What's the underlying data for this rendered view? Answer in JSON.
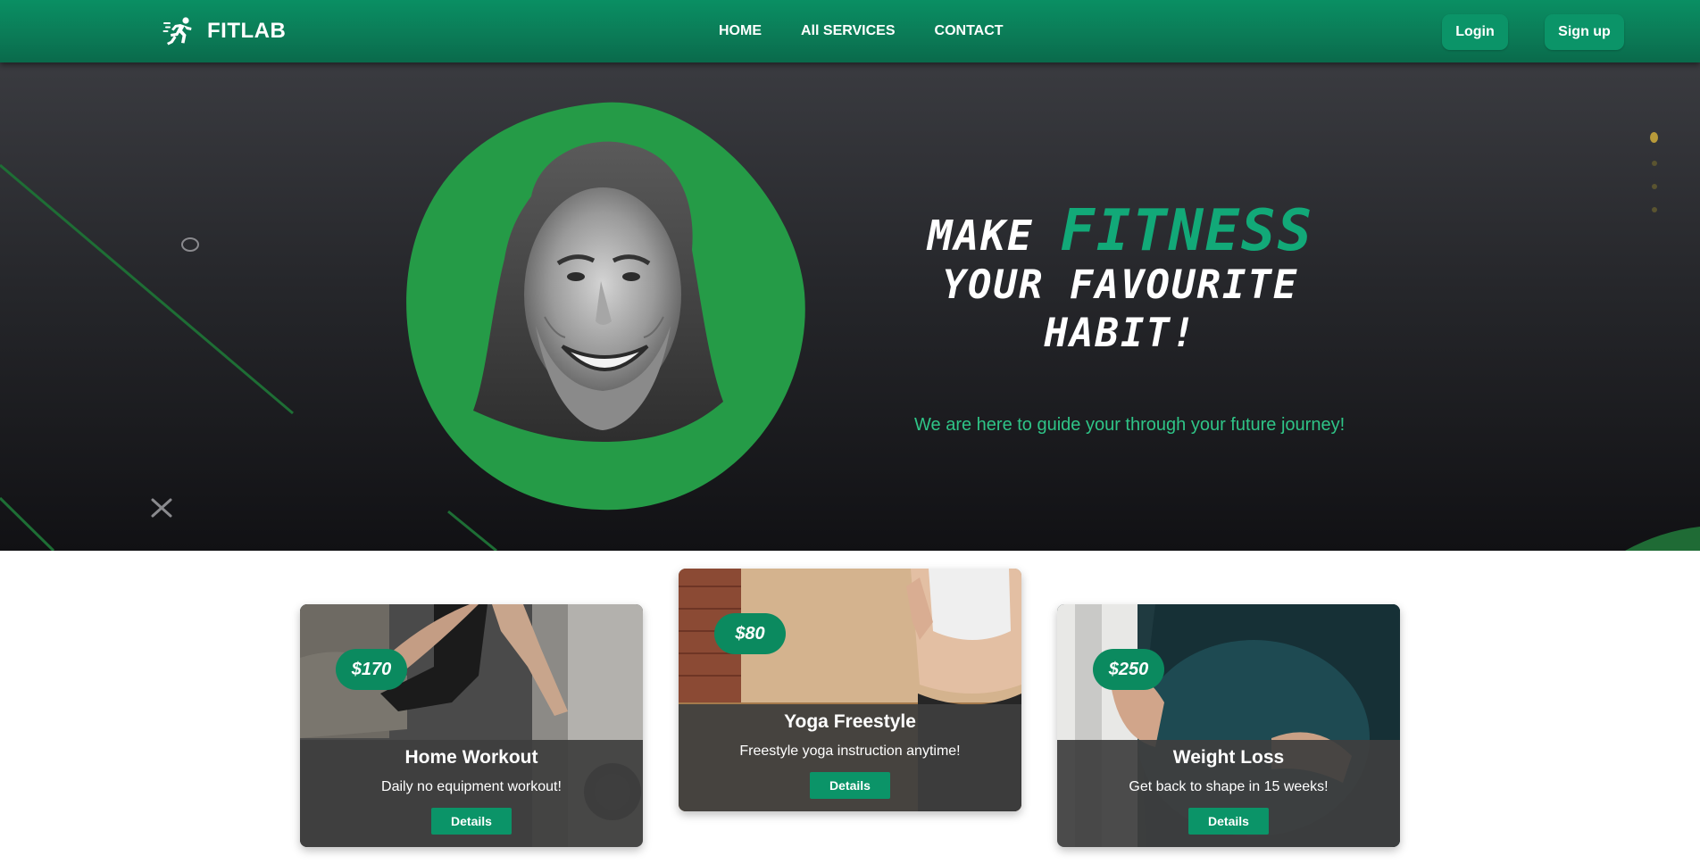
{
  "brand": {
    "name": "FITLAB",
    "icon": "runner-icon"
  },
  "nav": {
    "links": [
      {
        "label": "HOME"
      },
      {
        "label": "All SERVICES"
      },
      {
        "label": "CONTACT"
      }
    ],
    "login_label": "Login",
    "signup_label": "Sign up"
  },
  "hero": {
    "title_prefix": "MAKE",
    "title_accent": "FITNESS",
    "title_line2": "YOUR FAVOURITE HABIT!",
    "subtitle": "We are here to guide your through your future journey!",
    "slides_count": 4,
    "active_slide": 1
  },
  "cards": [
    {
      "title": "Home Workout",
      "description": "Daily no equipment workout!",
      "price": "$170",
      "button_label": "Details"
    },
    {
      "title": "Yoga Freestyle",
      "description": "Freestyle yoga instruction anytime!",
      "price": "$80",
      "button_label": "Details"
    },
    {
      "title": "Weight Loss",
      "description": "Get back to shape in 15 weeks!",
      "price": "$250",
      "button_label": "Details"
    }
  ],
  "colors": {
    "brand_green": "#0b9468",
    "accent_text": "#12a978",
    "subtitle_green": "#2fc487",
    "blob_green": "#259b47"
  }
}
